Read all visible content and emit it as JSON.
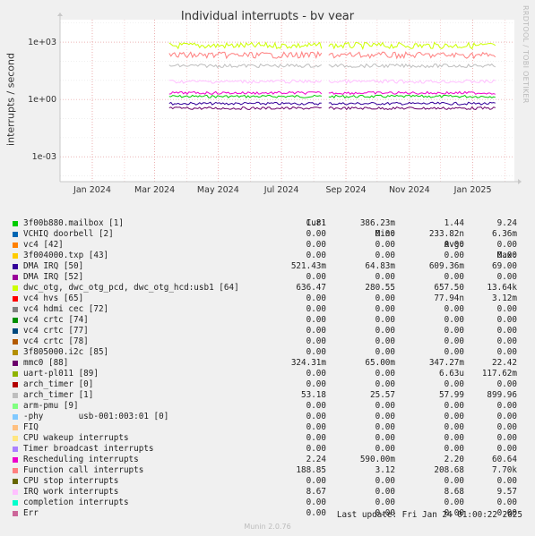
{
  "title": "Individual interrupts - by year",
  "side_label": "RRDTOOL / TOBI OETIKER",
  "y_label": "interrupts / second",
  "footer": "Munin 2.0.76",
  "last_update": "Last update: Fri Jan 24 01:00:22 2025",
  "legend_headers": {
    "cur": "Cur:",
    "min": "Min:",
    "avg": "Avg:",
    "max": "Max:"
  },
  "chart_data": {
    "type": "line",
    "title": "Individual interrupts - by year",
    "ylabel": "interrupts / second",
    "y_scale": "log",
    "ylim": [
      5e-05,
      15000
    ],
    "y_ticks": [
      {
        "value": 1000,
        "label": "1e+03"
      },
      {
        "value": 1,
        "label": "1e+00"
      },
      {
        "value": 0.001,
        "label": "1e-03"
      }
    ],
    "x_range": [
      "2023-12-01",
      "2025-02-10"
    ],
    "x_ticks": [
      {
        "date": "2024-01-01",
        "label": "Jan 2024"
      },
      {
        "date": "2024-03-01",
        "label": "Mar 2024"
      },
      {
        "date": "2024-05-01",
        "label": "May 2024"
      },
      {
        "date": "2024-07-01",
        "label": "Jul 2024"
      },
      {
        "date": "2024-09-01",
        "label": "Sep 2024"
      },
      {
        "date": "2024-11-01",
        "label": "Nov 2024"
      },
      {
        "date": "2025-01-01",
        "label": "Jan 2025"
      }
    ],
    "grid": true,
    "data_start": "2024-03-15",
    "series": [
      {
        "name": "3f00b880.mailbox [1]",
        "color": "#00cc00",
        "level": 1.44,
        "cur": "1.81",
        "min": "386.23m",
        "avg": "1.44",
        "max": "9.24"
      },
      {
        "name": "VCHIQ doorbell [2]",
        "color": "#0066b3",
        "level": 0,
        "cur": "0.00",
        "min": "0.00",
        "avg": "233.82n",
        "max": "6.36m"
      },
      {
        "name": "vc4 [42]",
        "color": "#ff8000",
        "level": 0,
        "cur": "0.00",
        "min": "0.00",
        "avg": "0.00",
        "max": "0.00"
      },
      {
        "name": "3f004000.txp [43]",
        "color": "#ffcc00",
        "level": 0,
        "cur": "0.00",
        "min": "0.00",
        "avg": "0.00",
        "max": "0.00"
      },
      {
        "name": "DMA IRQ [50]",
        "color": "#330099",
        "level": 0.609,
        "cur": "521.43m",
        "min": "64.83m",
        "avg": "609.36m",
        "max": "69.00"
      },
      {
        "name": "DMA IRQ [52]",
        "color": "#990099",
        "level": 0,
        "cur": "0.00",
        "min": "0.00",
        "avg": "0.00",
        "max": "0.00"
      },
      {
        "name": "dwc_otg, dwc_otg_pcd, dwc_otg_hcd:usb1 [64]",
        "color": "#ccff00",
        "level": 657.5,
        "cur": "636.47",
        "min": "280.55",
        "avg": "657.50",
        "max": "13.64k"
      },
      {
        "name": "vc4 hvs [65]",
        "color": "#ff0000",
        "level": 0,
        "cur": "0.00",
        "min": "0.00",
        "avg": "77.94n",
        "max": "3.12m"
      },
      {
        "name": "vc4 hdmi cec [72]",
        "color": "#808080",
        "level": 0,
        "cur": "0.00",
        "min": "0.00",
        "avg": "0.00",
        "max": "0.00"
      },
      {
        "name": "vc4 crtc [74]",
        "color": "#008f00",
        "level": 0,
        "cur": "0.00",
        "min": "0.00",
        "avg": "0.00",
        "max": "0.00"
      },
      {
        "name": "vc4 crtc [77]",
        "color": "#00487d",
        "level": 0,
        "cur": "0.00",
        "min": "0.00",
        "avg": "0.00",
        "max": "0.00"
      },
      {
        "name": "vc4 crtc [78]",
        "color": "#b35a00",
        "level": 0,
        "cur": "0.00",
        "min": "0.00",
        "avg": "0.00",
        "max": "0.00"
      },
      {
        "name": "3f805000.i2c [85]",
        "color": "#b38f00",
        "level": 0,
        "cur": "0.00",
        "min": "0.00",
        "avg": "0.00",
        "max": "0.00"
      },
      {
        "name": "mmc0 [88]",
        "color": "#6b006b",
        "level": 0.347,
        "cur": "324.31m",
        "min": "65.00m",
        "avg": "347.27m",
        "max": "22.42"
      },
      {
        "name": "uart-pl011 [89]",
        "color": "#8fb300",
        "level": 0,
        "cur": "0.00",
        "min": "0.00",
        "avg": "6.63u",
        "max": "117.62m"
      },
      {
        "name": "arch_timer [0]",
        "color": "#b30000",
        "level": 0,
        "cur": "0.00",
        "min": "0.00",
        "avg": "0.00",
        "max": "0.00"
      },
      {
        "name": "arch_timer [1]",
        "color": "#bebebe",
        "level": 57.99,
        "cur": "53.18",
        "min": "25.57",
        "avg": "57.99",
        "max": "899.96"
      },
      {
        "name": "arm-pmu [9]",
        "color": "#80ff80",
        "level": 0,
        "cur": "0.00",
        "min": "0.00",
        "avg": "0.00",
        "max": "0.00"
      },
      {
        "name": "-phy       usb-001:003:01 [0]",
        "color": "#80c9ff",
        "level": 0,
        "cur": "0.00",
        "min": "0.00",
        "avg": "0.00",
        "max": "0.00"
      },
      {
        "name": "FIQ",
        "color": "#ffc080",
        "level": 0,
        "cur": "0.00",
        "min": "0.00",
        "avg": "0.00",
        "max": "0.00"
      },
      {
        "name": "CPU wakeup interrupts",
        "color": "#ffe680",
        "level": 0,
        "cur": "0.00",
        "min": "0.00",
        "avg": "0.00",
        "max": "0.00"
      },
      {
        "name": "Timer broadcast interrupts",
        "color": "#aa80ff",
        "level": 0,
        "cur": "0.00",
        "min": "0.00",
        "avg": "0.00",
        "max": "0.00"
      },
      {
        "name": "Rescheduling interrupts",
        "color": "#ee00cc",
        "level": 2.2,
        "cur": "2.24",
        "min": "590.00m",
        "avg": "2.20",
        "max": "60.64"
      },
      {
        "name": "Function call interrupts",
        "color": "#ff8080",
        "level": 208.68,
        "cur": "188.85",
        "min": "3.12",
        "avg": "208.68",
        "max": "7.70k"
      },
      {
        "name": "CPU stop interrupts",
        "color": "#666600",
        "level": 0,
        "cur": "0.00",
        "min": "0.00",
        "avg": "0.00",
        "max": "0.00"
      },
      {
        "name": "IRQ work interrupts",
        "color": "#ffbfff",
        "level": 8.68,
        "cur": "8.67",
        "min": "0.00",
        "avg": "8.68",
        "max": "9.57"
      },
      {
        "name": "completion interrupts",
        "color": "#00ffcc",
        "level": 0,
        "cur": "0.00",
        "min": "0.00",
        "avg": "0.00",
        "max": "0.00"
      },
      {
        "name": "Err",
        "color": "#cc6699",
        "level": 0,
        "cur": "0.00",
        "min": "0.00",
        "avg": "0.00",
        "max": "0.00"
      }
    ]
  }
}
